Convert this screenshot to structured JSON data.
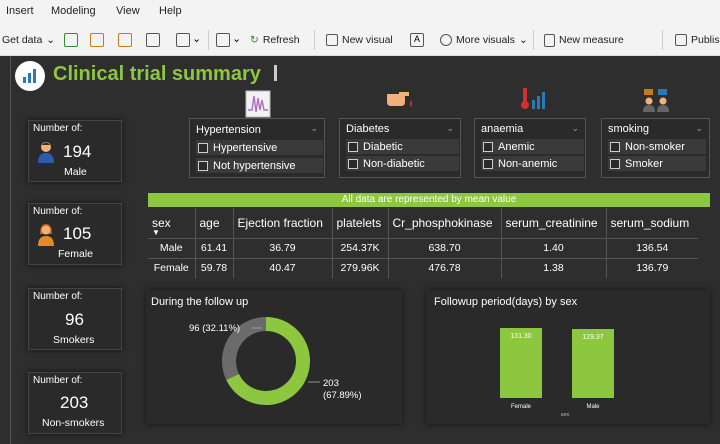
{
  "menu": [
    "Insert",
    "Modeling",
    "View",
    "Help"
  ],
  "toolbar": {
    "get_data": "Get data",
    "refresh": "Refresh",
    "new_visual": "New visual",
    "more_visuals": "More visuals",
    "new_measure": "New measure",
    "publish": "Publis"
  },
  "report": {
    "title": "Clinical trial summary"
  },
  "cards": [
    {
      "label": "Number of:",
      "value": "194",
      "sub": "Male"
    },
    {
      "label": "Number of:",
      "value": "105",
      "sub": "Female"
    },
    {
      "label": "Number of:",
      "value": "96",
      "sub": "Smokers"
    },
    {
      "label": "Number of:",
      "value": "203",
      "sub": "Non-smokers"
    }
  ],
  "slicers": [
    {
      "header": "Hypertension",
      "options": [
        "Hypertensive",
        "Not hypertensive"
      ]
    },
    {
      "header": "Diabetes",
      "options": [
        "Diabetic",
        "Non-diabetic"
      ]
    },
    {
      "header": "anaemia",
      "options": [
        "Anemic",
        "Non-anemic"
      ]
    },
    {
      "header": "smoking",
      "options": [
        "Non-smoker",
        "Smoker"
      ]
    }
  ],
  "banner": "All data are represented by mean value",
  "table": {
    "columns": [
      "sex",
      "age",
      "Ejection fraction",
      "platelets",
      "Cr_phosphokinase",
      "serum_creatinine",
      "serum_sodium"
    ],
    "rows": [
      [
        "Male",
        "61.41",
        "36.79",
        "254.37K",
        "638.70",
        "1.40",
        "136.54"
      ],
      [
        "Female",
        "59.78",
        "40.47",
        "279.96K",
        "476.78",
        "1.38",
        "136.79"
      ]
    ]
  },
  "chart_data": [
    {
      "type": "pie",
      "title": "During the follow up",
      "values": [
        96,
        203
      ],
      "labels": [
        "96 (32.11%)",
        "203\n(67.89%)"
      ],
      "colors": [
        "#6b6b6b",
        "#8dc63f"
      ]
    },
    {
      "type": "bar",
      "title": "Followup period(days) by sex",
      "categories": [
        "Female",
        "Male"
      ],
      "values": [
        131.3,
        129.37
      ],
      "data_labels": [
        "131.30",
        "129.37"
      ],
      "xlabel": "sex",
      "color": "#8dc63f"
    }
  ]
}
